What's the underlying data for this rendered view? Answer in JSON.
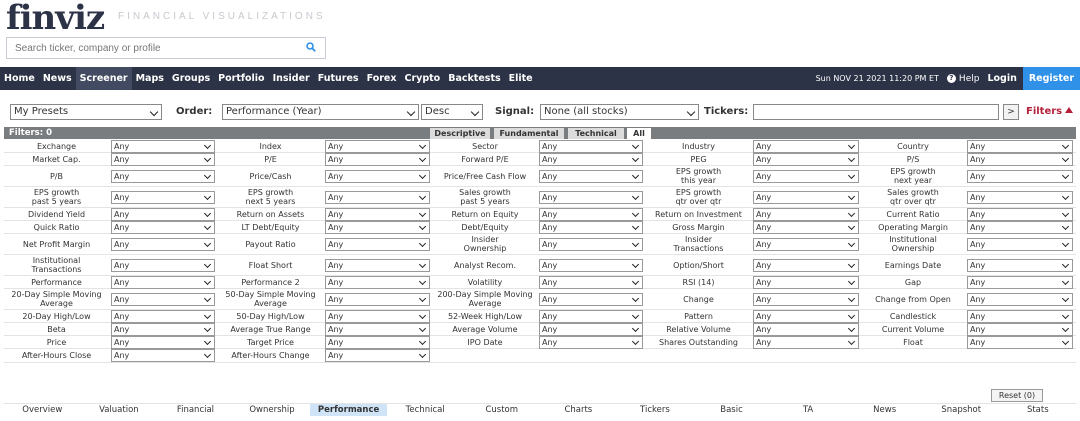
{
  "header": {
    "logo": "finviz",
    "tagline": "FINANCIAL VISUALIZATIONS",
    "search_placeholder": "Search ticker, company or profile"
  },
  "nav": {
    "items": [
      "Home",
      "News",
      "Screener",
      "Maps",
      "Groups",
      "Portfolio",
      "Insider",
      "Futures",
      "Forex",
      "Crypto",
      "Backtests",
      "Elite"
    ],
    "active": "Screener",
    "datetime": "Sun NOV 21 2021 11:20 PM ET",
    "help": "Help",
    "login": "Login",
    "register": "Register"
  },
  "controls": {
    "presets": "My Presets",
    "order_label": "Order:",
    "order_value": "Performance (Year)",
    "direction": "Desc",
    "signal_label": "Signal:",
    "signal_value": "None (all stocks)",
    "tickers_label": "Tickers:",
    "arrow": ">",
    "filters_toggle": "Filters"
  },
  "filter_bar": {
    "count": "Filters: 0",
    "tabs": [
      "Descriptive",
      "Fundamental",
      "Technical",
      "All"
    ],
    "active_tab": "All"
  },
  "filters": [
    [
      [
        "Exchange",
        "Any"
      ],
      [
        "Index",
        "Any"
      ],
      [
        "Sector",
        "Any"
      ],
      [
        "Industry",
        "Any"
      ],
      [
        "Country",
        "Any"
      ]
    ],
    [
      [
        "Market Cap.",
        "Any"
      ],
      [
        "P/E",
        "Any"
      ],
      [
        "Forward P/E",
        "Any"
      ],
      [
        "PEG",
        "Any"
      ],
      [
        "P/S",
        "Any"
      ]
    ],
    [
      [
        "P/B",
        "Any"
      ],
      [
        "Price/Cash",
        "Any"
      ],
      [
        "Price/Free Cash Flow",
        "Any"
      ],
      [
        "EPS growth\nthis year",
        "Any"
      ],
      [
        "EPS growth\nnext year",
        "Any"
      ]
    ],
    [
      [
        "EPS growth\npast 5 years",
        "Any"
      ],
      [
        "EPS growth\nnext 5 years",
        "Any"
      ],
      [
        "Sales growth\npast 5 years",
        "Any"
      ],
      [
        "EPS growth\nqtr over qtr",
        "Any"
      ],
      [
        "Sales growth\nqtr over qtr",
        "Any"
      ]
    ],
    [
      [
        "Dividend Yield",
        "Any"
      ],
      [
        "Return on Assets",
        "Any"
      ],
      [
        "Return on Equity",
        "Any"
      ],
      [
        "Return on Investment",
        "Any"
      ],
      [
        "Current Ratio",
        "Any"
      ]
    ],
    [
      [
        "Quick Ratio",
        "Any"
      ],
      [
        "LT Debt/Equity",
        "Any"
      ],
      [
        "Debt/Equity",
        "Any"
      ],
      [
        "Gross Margin",
        "Any"
      ],
      [
        "Operating Margin",
        "Any"
      ]
    ],
    [
      [
        "Net Profit Margin",
        "Any"
      ],
      [
        "Payout Ratio",
        "Any"
      ],
      [
        "Insider\nOwnership",
        "Any"
      ],
      [
        "Insider\nTransactions",
        "Any"
      ],
      [
        "Institutional\nOwnership",
        "Any"
      ]
    ],
    [
      [
        "Institutional\nTransactions",
        "Any"
      ],
      [
        "Float Short",
        "Any"
      ],
      [
        "Analyst Recom.",
        "Any"
      ],
      [
        "Option/Short",
        "Any"
      ],
      [
        "Earnings Date",
        "Any"
      ]
    ],
    [
      [
        "Performance",
        "Any"
      ],
      [
        "Performance 2",
        "Any"
      ],
      [
        "Volatility",
        "Any"
      ],
      [
        "RSI (14)",
        "Any"
      ],
      [
        "Gap",
        "Any"
      ]
    ],
    [
      [
        "20-Day Simple Moving\nAverage",
        "Any"
      ],
      [
        "50-Day Simple Moving\nAverage",
        "Any"
      ],
      [
        "200-Day Simple Moving\nAverage",
        "Any"
      ],
      [
        "Change",
        "Any"
      ],
      [
        "Change from Open",
        "Any"
      ]
    ],
    [
      [
        "20-Day High/Low",
        "Any"
      ],
      [
        "50-Day High/Low",
        "Any"
      ],
      [
        "52-Week High/Low",
        "Any"
      ],
      [
        "Pattern",
        "Any"
      ],
      [
        "Candlestick",
        "Any"
      ]
    ],
    [
      [
        "Beta",
        "Any"
      ],
      [
        "Average True Range",
        "Any"
      ],
      [
        "Average Volume",
        "Any"
      ],
      [
        "Relative Volume",
        "Any"
      ],
      [
        "Current Volume",
        "Any"
      ]
    ],
    [
      [
        "Price",
        "Any"
      ],
      [
        "Target Price",
        "Any"
      ],
      [
        "IPO Date",
        "Any"
      ],
      [
        "Shares Outstanding",
        "Any"
      ],
      [
        "Float",
        "Any"
      ]
    ],
    [
      [
        "After-Hours Close",
        "Any"
      ],
      [
        "After-Hours Change",
        "Any"
      ]
    ]
  ],
  "reset": "Reset (0)",
  "view_tabs": [
    "Overview",
    "Valuation",
    "Financial",
    "Ownership",
    "Performance",
    "Technical",
    "Custom",
    "Charts",
    "Tickers",
    "Basic",
    "TA",
    "News",
    "Snapshot",
    "Stats"
  ],
  "active_view": "Performance"
}
